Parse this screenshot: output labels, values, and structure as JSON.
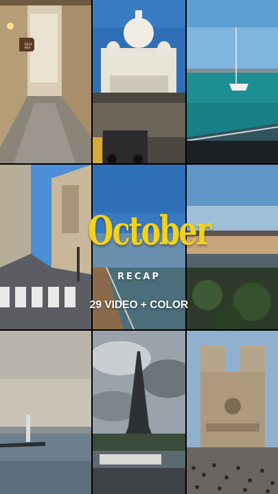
{
  "headline": {
    "title": "October",
    "subtitle": "RECAP",
    "caption": "29 VIDEO + COLOR"
  },
  "signs": {
    "shop_sign": "DEUX\nMÉA"
  },
  "colors": {
    "title_yellow": "#f4d21a",
    "sky_blue": "#2f6fb8",
    "sea_teal": "#1e8e95"
  }
}
